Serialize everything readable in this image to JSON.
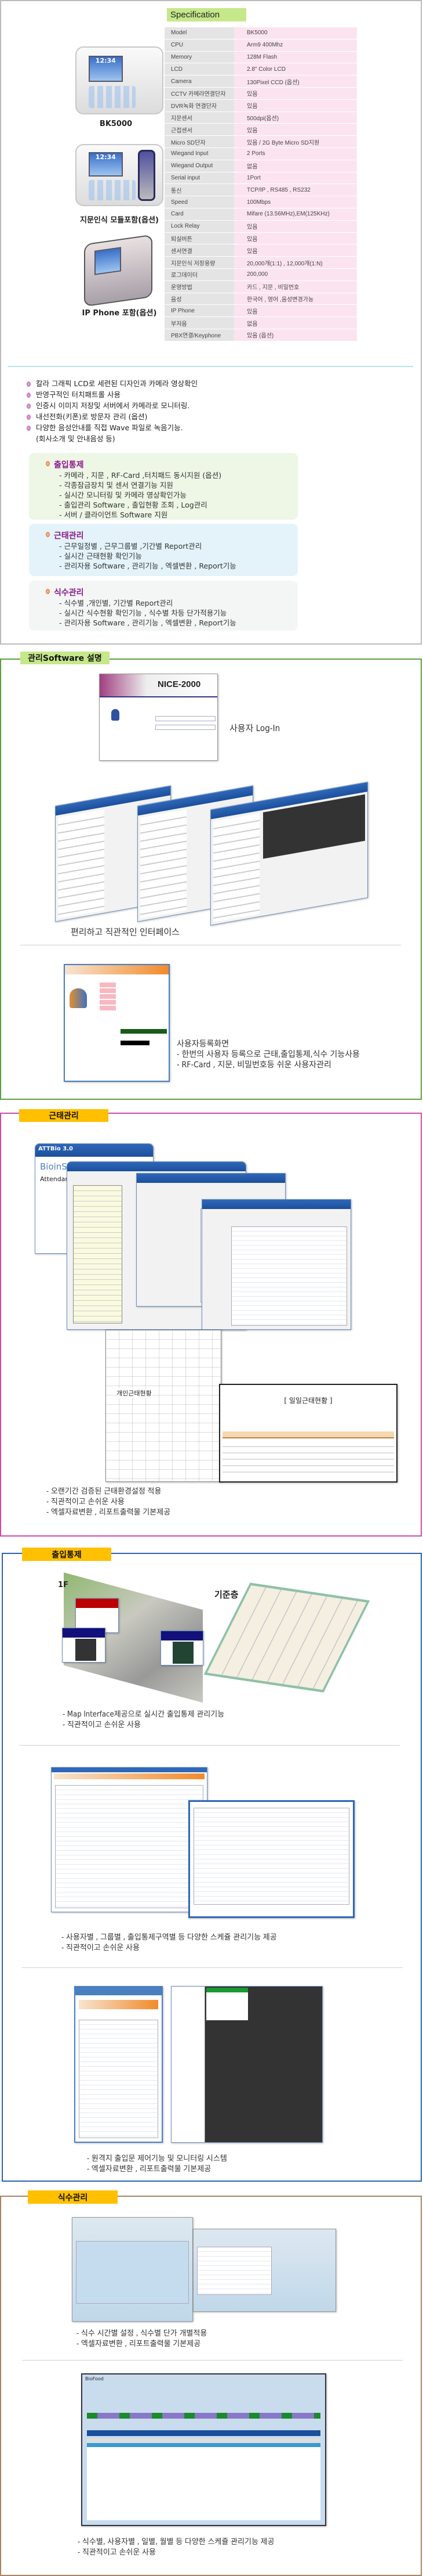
{
  "products": [
    {
      "name": "BK5000",
      "lcd_time": "12:34"
    },
    {
      "name": "지문인식 모듈포함(옵션)",
      "lcd_time": "12:34"
    },
    {
      "name": "IP Phone 포함(옵션)",
      "lcd_time": ""
    }
  ],
  "spec": {
    "title": "Specification",
    "rows": [
      [
        "Model",
        "BK5000"
      ],
      [
        "CPU",
        "Arm9 400Mhz"
      ],
      [
        "Memory",
        "128M Flash"
      ],
      [
        "LCD",
        "2.8\" Color LCD"
      ],
      [
        "Camera",
        "130Pixel CCD (옵션)"
      ],
      [
        "CCTV 카메라연결단자",
        "있음"
      ],
      [
        "DVR녹화 연결단자",
        "있음"
      ],
      [
        "지문센서",
        "500dpi(옵션)"
      ],
      [
        "근접센서",
        "있음"
      ],
      [
        "Micro SD단자",
        "있음 / 2G Byte Micro SD지원"
      ],
      [
        "Wiegand Input",
        "2 Ports"
      ],
      [
        "Wiegand Output",
        "없음"
      ],
      [
        "Serial input",
        "1Port"
      ],
      [
        "통신",
        "TCP/IP , RS485 , RS232"
      ],
      [
        "Speed",
        "100Mbps"
      ],
      [
        "Card",
        "Mifare (13.56MHz),EM(125KHz)"
      ],
      [
        "Lock Relay",
        "있음"
      ],
      [
        "퇴실버튼",
        "있음"
      ],
      [
        "센서연결",
        "있음"
      ],
      [
        "지문인식 저장용량",
        "20,000개(1:1) , 12,000개(1:N)"
      ],
      [
        "로그데이터",
        "200,000"
      ],
      [
        "운영방법",
        "카드 , 지문 , 비밀번호"
      ],
      [
        "음성",
        "한국어 , 영어 ,음성변경가능"
      ],
      [
        "IP Phone",
        "있음"
      ],
      [
        "부저음",
        "없음"
      ],
      [
        "PBX연결/Keyphone",
        "있음 (옵션)"
      ]
    ]
  },
  "features": [
    "칼라 그래픽 LCD로 세련된 디자인과 카메라 영상확인",
    "반영구적인 터치패트롤 사용",
    "인증시 이미지 저장및 서버에서 카메라로 모니터링.",
    "내선전화(키폰)로 방문자 관리 (옵션)",
    "다양한 음성안내를 직접 Wave 파일로 녹음기능.",
    "(회사소개 및 안내음성 등)"
  ],
  "feature_boxes": [
    {
      "title": "출입통제",
      "items": [
        "- 카메라 , 지문 , RF-Card ,터치패드 동시지원 (옵션)",
        "- 각종잠금장치 및 센서 연결기능 지원",
        "- 실시간 모니터링 및 카메라 영상확인가능",
        "- 출입관리 Software , 출입현황 조회 , Log관리",
        "- 서버 / 클라이언트 Software 지원"
      ],
      "bg": "#eef6e6"
    },
    {
      "title": "근태관리",
      "items": [
        "- 근무일정별 , 근무그룹별 ,기간별 Report관리",
        "- 실시간 근태현황 확인기능",
        "- 관리자용 Software , 관리기능 , 엑셀변환 , Report기능"
      ],
      "bg": "#e3f3f9"
    },
    {
      "title": "식수관리",
      "items": [
        "- 식수별 ,개인별, 기간별 Report관리",
        "- 실시간 식수현황 확인기능 , 식수별 차등 단가적용기능",
        "- 관리자용 Software , 관리기능 , 엑셀변환 , Report기능"
      ],
      "bg": "#f4f5f5"
    }
  ],
  "sections": {
    "software": {
      "tab": "관리Software 설명",
      "color": "#5aa040",
      "tab_color": "#c5e88a",
      "login_title": "NICE-2000",
      "login_caption": "사용자 Log-In",
      "interface_caption": "편리하고 직관적인 인터페이스",
      "reg_caption": [
        "사용자등록화면",
        "- 한번의 사용자 등록으로 근태,출입통제,식수 기능사용",
        "- RF-Card , 지문, 비밀번호등 쉬운 사용자관리"
      ]
    },
    "attendance": {
      "tab": "근태관리",
      "color": "#d04aa8",
      "tab_color": "#ffc000",
      "app_title": "ATTBio 3.0",
      "app_brand": "BioinSec",
      "app_sub": "Attendance",
      "sheet_title": "개인근태현황",
      "report_title": "[ 일일근태현황 ]",
      "caption": [
        "- 오랜기간 검증된 근태환경설정 적용",
        "- 직관적이고 손쉬운 사용",
        "- 엑셀자료변환 , 리포트출력물 기본제공"
      ]
    },
    "access": {
      "tab": "출입통제",
      "color": "#2a62b0",
      "tab_color": "#ffc000",
      "map_floor1": "1F",
      "map_floor2": "기준층",
      "caption1": [
        "- Map Interface제공으로 실시간 출입통제 관리기능",
        "- 직관적이고 손쉬운 사용"
      ],
      "caption2": [
        "- 사용자별 , 그룹별 , 출입통제구역별 등 다양한 스케쥴 관리기능 제공",
        "- 직관적이고 손쉬운 사용"
      ],
      "caption3": [
        "- 원격지 출입문 제어기능 및 모니터링 시스템",
        "- 엑셀자료변환 , 리포트출력물 기본제공"
      ]
    },
    "meal": {
      "tab": "식수관리",
      "color": "#a88560",
      "tab_color": "#ffc000",
      "app_title": "BioFood",
      "caption1": [
        "- 식수 시간별 설정 , 식수별 단가 개별적용",
        "- 엑셀자료변환 , 리포트출력물 기본제공"
      ],
      "caption2": [
        "- 식수별, 사용자별 , 일별, 월별 등 다양한 스케쥴 관리기능 제공",
        "- 직관적이고 손쉬운 사용"
      ]
    }
  }
}
